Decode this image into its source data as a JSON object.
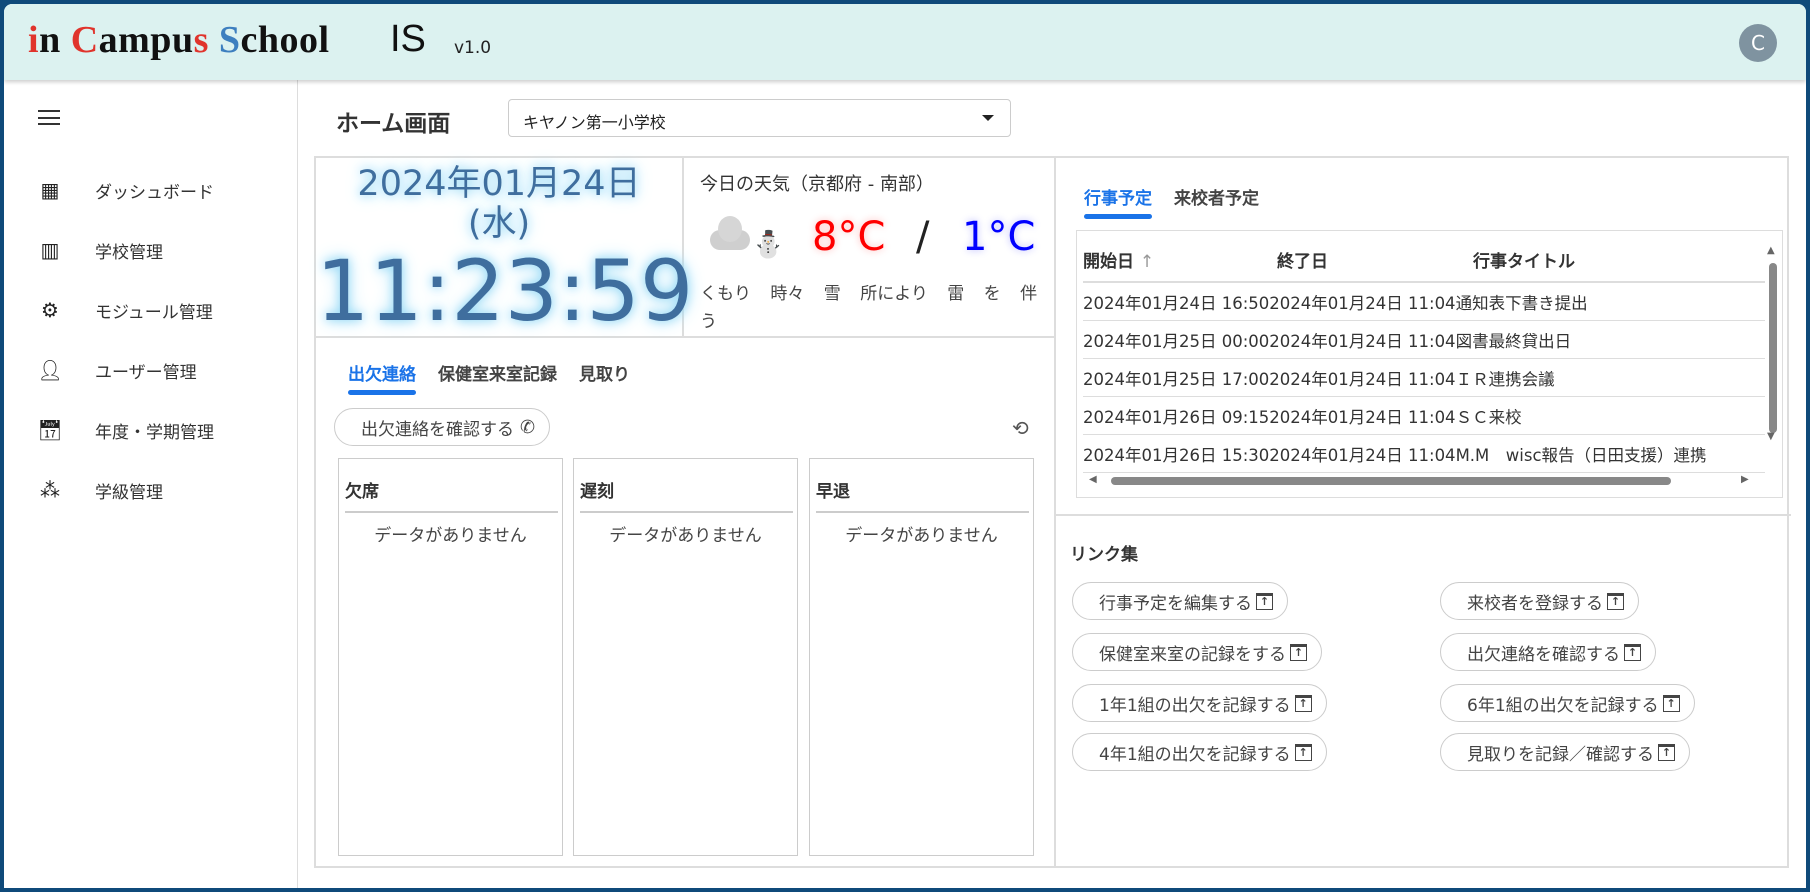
{
  "header": {
    "logo": "in Campus School",
    "product": "IS",
    "version": "v1.0",
    "avatar": "C"
  },
  "sidebar": {
    "items": [
      {
        "label": "ダッシュボード",
        "icon": "dashboard-icon"
      },
      {
        "label": "学校管理",
        "icon": "building-icon"
      },
      {
        "label": "モジュール管理",
        "icon": "module-settings-icon"
      },
      {
        "label": "ユーザー管理",
        "icon": "user-icon"
      },
      {
        "label": "年度・学期管理",
        "icon": "calendar-icon"
      },
      {
        "label": "学級管理",
        "icon": "group-icon"
      }
    ]
  },
  "page": {
    "title": "ホーム画面",
    "school": "キヤノン第一小学校"
  },
  "clock": {
    "date": "2024年01月24日",
    "weekday": "(水)",
    "time": "11:23:59"
  },
  "weather": {
    "title": "今日の天気（京都府 - 南部）",
    "high": "8°C",
    "separator": "/",
    "low": "1°C",
    "description": "くもり 時々 雪 所により 雷 を 伴う"
  },
  "attendance": {
    "tabs": [
      "出欠連絡",
      "保健室来室記録",
      "見取り"
    ],
    "confirm_button": "出欠連絡を確認する",
    "columns": [
      {
        "title": "欠席",
        "empty": "データがありません"
      },
      {
        "title": "遅刻",
        "empty": "データがありません"
      },
      {
        "title": "早退",
        "empty": "データがありません"
      }
    ]
  },
  "events": {
    "tabs": [
      "行事予定",
      "来校者予定"
    ],
    "headers": [
      "開始日",
      "終了日",
      "行事タイトル"
    ],
    "rows": [
      [
        "2024年01月24日 16:50",
        "2024年01月24日 11:04",
        "通知表下書き提出"
      ],
      [
        "2024年01月25日 00:00",
        "2024年01月24日 11:04",
        "図書最終貸出日"
      ],
      [
        "2024年01月25日 17:00",
        "2024年01月24日 11:04",
        "ＩＲ連携会議"
      ],
      [
        "2024年01月26日 09:15",
        "2024年01月24日 11:04",
        "ＳＣ来校"
      ],
      [
        "2024年01月26日 15:30",
        "2024年01月24日 11:04",
        "M.M　wisc報告（日田支援）連携"
      ]
    ]
  },
  "links": {
    "title": "リンク集",
    "items": [
      "行事予定を編集する",
      "来校者を登録する",
      "保健室来室の記録をする",
      "出欠連絡を確認する",
      "1年1組の出欠を記録する",
      "6年1組の出欠を記録する",
      "4年1組の出欠を記録する",
      "見取りを記録／確認する"
    ]
  }
}
